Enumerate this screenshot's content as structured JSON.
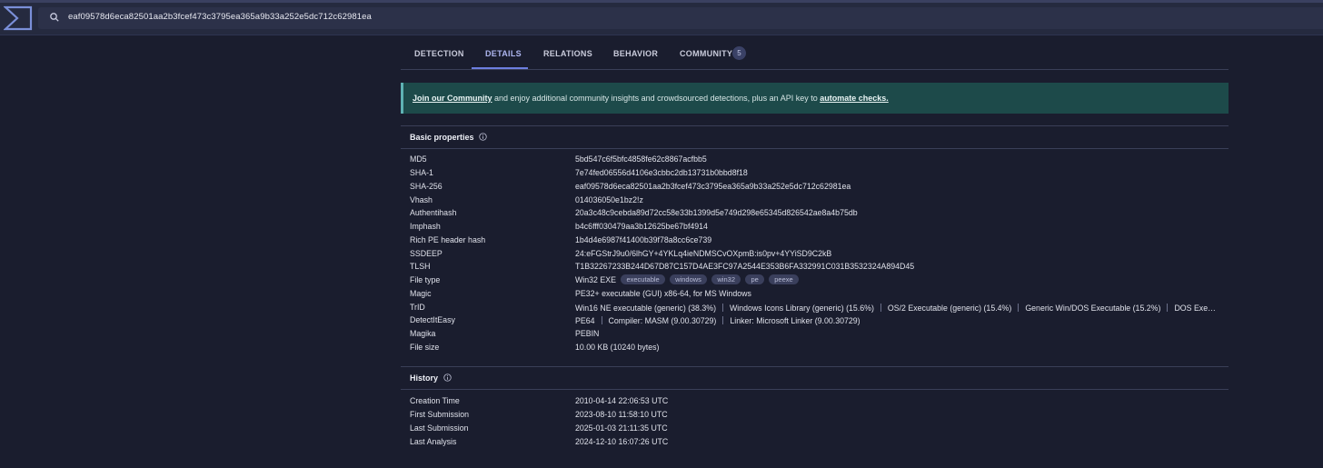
{
  "search": {
    "query": "eaf09578d6eca82501aa2b3fcef473c3795ea365a9b33a252e5dc712c62981ea"
  },
  "tabs": [
    {
      "label": "DETECTION"
    },
    {
      "label": "DETAILS"
    },
    {
      "label": "RELATIONS"
    },
    {
      "label": "BEHAVIOR"
    },
    {
      "label": "COMMUNITY"
    }
  ],
  "community_count": "5",
  "banner": {
    "link1": "Join our Community",
    "text": " and enjoy additional community insights and crowdsourced detections, plus an API key to ",
    "link2": "automate checks."
  },
  "basic": {
    "title": "Basic properties",
    "md5_key": "MD5",
    "md5": "5bd547c6f5bfc4858fe62c8867acfbb5",
    "sha1_key": "SHA-1",
    "sha1": "7e74fed06556d4106e3cbbc2db13731b0bbd8f18",
    "sha256_key": "SHA-256",
    "sha256": "eaf09578d6eca82501aa2b3fcef473c3795ea365a9b33a252e5dc712c62981ea",
    "vhash_key": "Vhash",
    "vhash": "014036050e1bz2!z",
    "authentihash_key": "Authentihash",
    "authentihash": "20a3c48c9cebda89d72cc58e33b1399d5e749d298e65345d826542ae8a4b75db",
    "imphash_key": "Imphash",
    "imphash": "b4c6fff030479aa3b12625be67bf4914",
    "rich_key": "Rich PE header hash",
    "rich": "1b4d4e6987f41400b39f78a8cc6ce739",
    "ssdeep_key": "SSDEEP",
    "ssdeep": "24:eFGStrJ9u0/6lhGY+4YKLq4ieNDMSCvOXpmB:is0pv+4YYiSD9C2kB",
    "tlsh_key": "TLSH",
    "tlsh": "T1B32267233B244D67D87C157D4AE3FC97A2544E353B6FA332991C031B3532324A894D45",
    "filetype_key": "File type",
    "filetype": "Win32 EXE",
    "filetype_tags": [
      "executable",
      "windows",
      "win32",
      "pe",
      "peexe"
    ],
    "magic_key": "Magic",
    "magic": "PE32+ executable (GUI) x86-64, for MS Windows",
    "trid_key": "TrID",
    "trid": [
      "Win16 NE executable (generic) (38.3%)",
      "Windows Icons Library (generic) (15.6%)",
      "OS/2 Executable (generic) (15.4%)",
      "Generic Win/DOS Executable (15.2%)",
      "DOS Exe…"
    ],
    "die_key": "DetectItEasy",
    "die": [
      "PE64",
      "Compiler: MASM (9.00.30729)",
      "Linker: Microsoft Linker (9.00.30729)"
    ],
    "magika_key": "Magika",
    "magika": "PEBIN",
    "filesize_key": "File size",
    "filesize": "10.00 KB (10240 bytes)"
  },
  "history": {
    "title": "History",
    "creation_key": "Creation Time",
    "creation": "2010-04-14 22:06:53 UTC",
    "first_key": "First Submission",
    "first": "2023-08-10 11:58:10 UTC",
    "last_key": "Last Submission",
    "last": "2025-01-03 21:11:35 UTC",
    "analysis_key": "Last Analysis",
    "analysis": "2024-12-10 16:07:26 UTC"
  }
}
